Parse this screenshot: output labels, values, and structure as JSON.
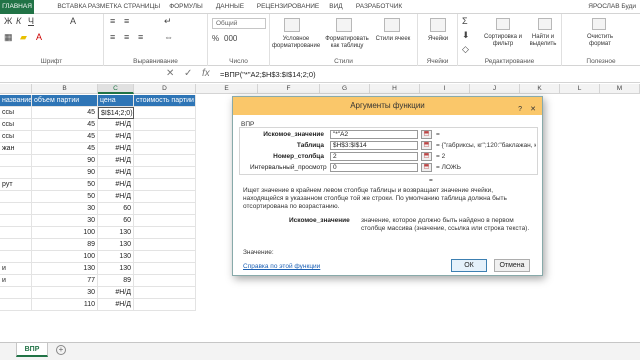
{
  "ribbon": {
    "tabs": [
      "ГЛАВНАЯ",
      "ВСТАВКА",
      "РАЗМЕТКА СТРАНИЦЫ",
      "ФОРМУЛЫ",
      "ДАННЫЕ",
      "РЕЦЕНЗИРОВАНИЕ",
      "ВИД",
      "РАЗРАБОТЧИК"
    ],
    "user": "ЯРОСЛАВ Буди",
    "groups": {
      "font": "Шрифт",
      "alignment": "Выравнивание",
      "number": "Число",
      "styles": "Стили",
      "cells": "Ячейки",
      "editing": "Редактирование"
    },
    "number_format": "Общий",
    "conditional_format": "Условное форматирование",
    "format_as_table": "Форматировать как таблицу",
    "cell_styles": "Стили ячеек",
    "cells_label": "Ячейки",
    "sort_filter": "Сортировка и фильтр",
    "find_select": "Найти и выделить",
    "clear_format": "Очистить формат",
    "useful": "Полезное"
  },
  "formula_bar": {
    "cancel": "✕",
    "enter": "✓",
    "fx": "fx",
    "formula": "=ВПР(\"*\"A2;$H$3:$I$14;2;0)"
  },
  "grid": {
    "columns": [
      "B",
      "C",
      "D",
      "E",
      "F",
      "G",
      "H",
      "I",
      "J",
      "K",
      "L",
      "M"
    ],
    "selected_column": "C",
    "headers": {
      "a": "название",
      "b": "объем партии",
      "c": "цена",
      "d": "стоимость партии"
    },
    "rows": [
      {
        "a": "ссы",
        "b": "45",
        "c": "$I$14;2;0)"
      },
      {
        "a": "ссы",
        "b": "45",
        "c": "#Н/Д"
      },
      {
        "a": "ссы",
        "b": "45",
        "c": "#Н/Д"
      },
      {
        "a": "жан",
        "b": "45",
        "c": "#Н/Д"
      },
      {
        "a": "",
        "b": "90",
        "c": "#Н/Д"
      },
      {
        "a": "",
        "b": "90",
        "c": "#Н/Д"
      },
      {
        "a": "рут",
        "b": "50",
        "c": "#Н/Д"
      },
      {
        "a": "",
        "b": "50",
        "c": "#Н/Д"
      },
      {
        "a": "",
        "b": "30",
        "c": "60"
      },
      {
        "a": "",
        "b": "30",
        "c": "60"
      },
      {
        "a": "",
        "b": "100",
        "c": "130"
      },
      {
        "a": "",
        "b": "89",
        "c": "130"
      },
      {
        "a": "",
        "b": "100",
        "c": "130"
      },
      {
        "a": "и",
        "b": "130",
        "c": "130"
      },
      {
        "a": "и",
        "b": "77",
        "c": "89"
      },
      {
        "a": "",
        "b": "30",
        "c": "#Н/Д"
      },
      {
        "a": "",
        "b": "110",
        "c": "#Н/Д"
      }
    ]
  },
  "dialog": {
    "title": "Аргументы функции",
    "help_btn": "?",
    "close_btn": "✕",
    "function_name": "ВПР",
    "args": [
      {
        "label": "Искомое_значение",
        "value": "\"*\"A2",
        "result": "="
      },
      {
        "label": "Таблица",
        "value": "$H$3:$I$14",
        "result": "= {\"габриксы, кг\";120:\"баклажан, кг\"...."
      },
      {
        "label": "Номер_столбца",
        "value": "2",
        "result": "= 2"
      },
      {
        "label": "Интервальный_просмотр",
        "value": "0",
        "result": "= ЛОЖЬ"
      }
    ],
    "result_eq": "=",
    "description": "Ищет значение в крайнем левом столбце таблицы и возвращает значение ячейки, находящейся в указанном столбце той же строки. По умолчанию таблица должна быть отсортирована по возрастанию.",
    "arg_desc_name": "Искомое_значение",
    "arg_desc": "значение, которое должно быть найдено в первом столбце массива (значение, ссылка или строка текста).",
    "value_label": "Значение:",
    "help_link": "Справка по этой функции",
    "ok": "ОК",
    "cancel": "Отмена"
  },
  "sheets": {
    "active": "ВПР",
    "add": "+"
  },
  "colors": {
    "excel_green": "#217346",
    "header_blue": "#2e75b6",
    "dialog_title": "#fac76a"
  }
}
